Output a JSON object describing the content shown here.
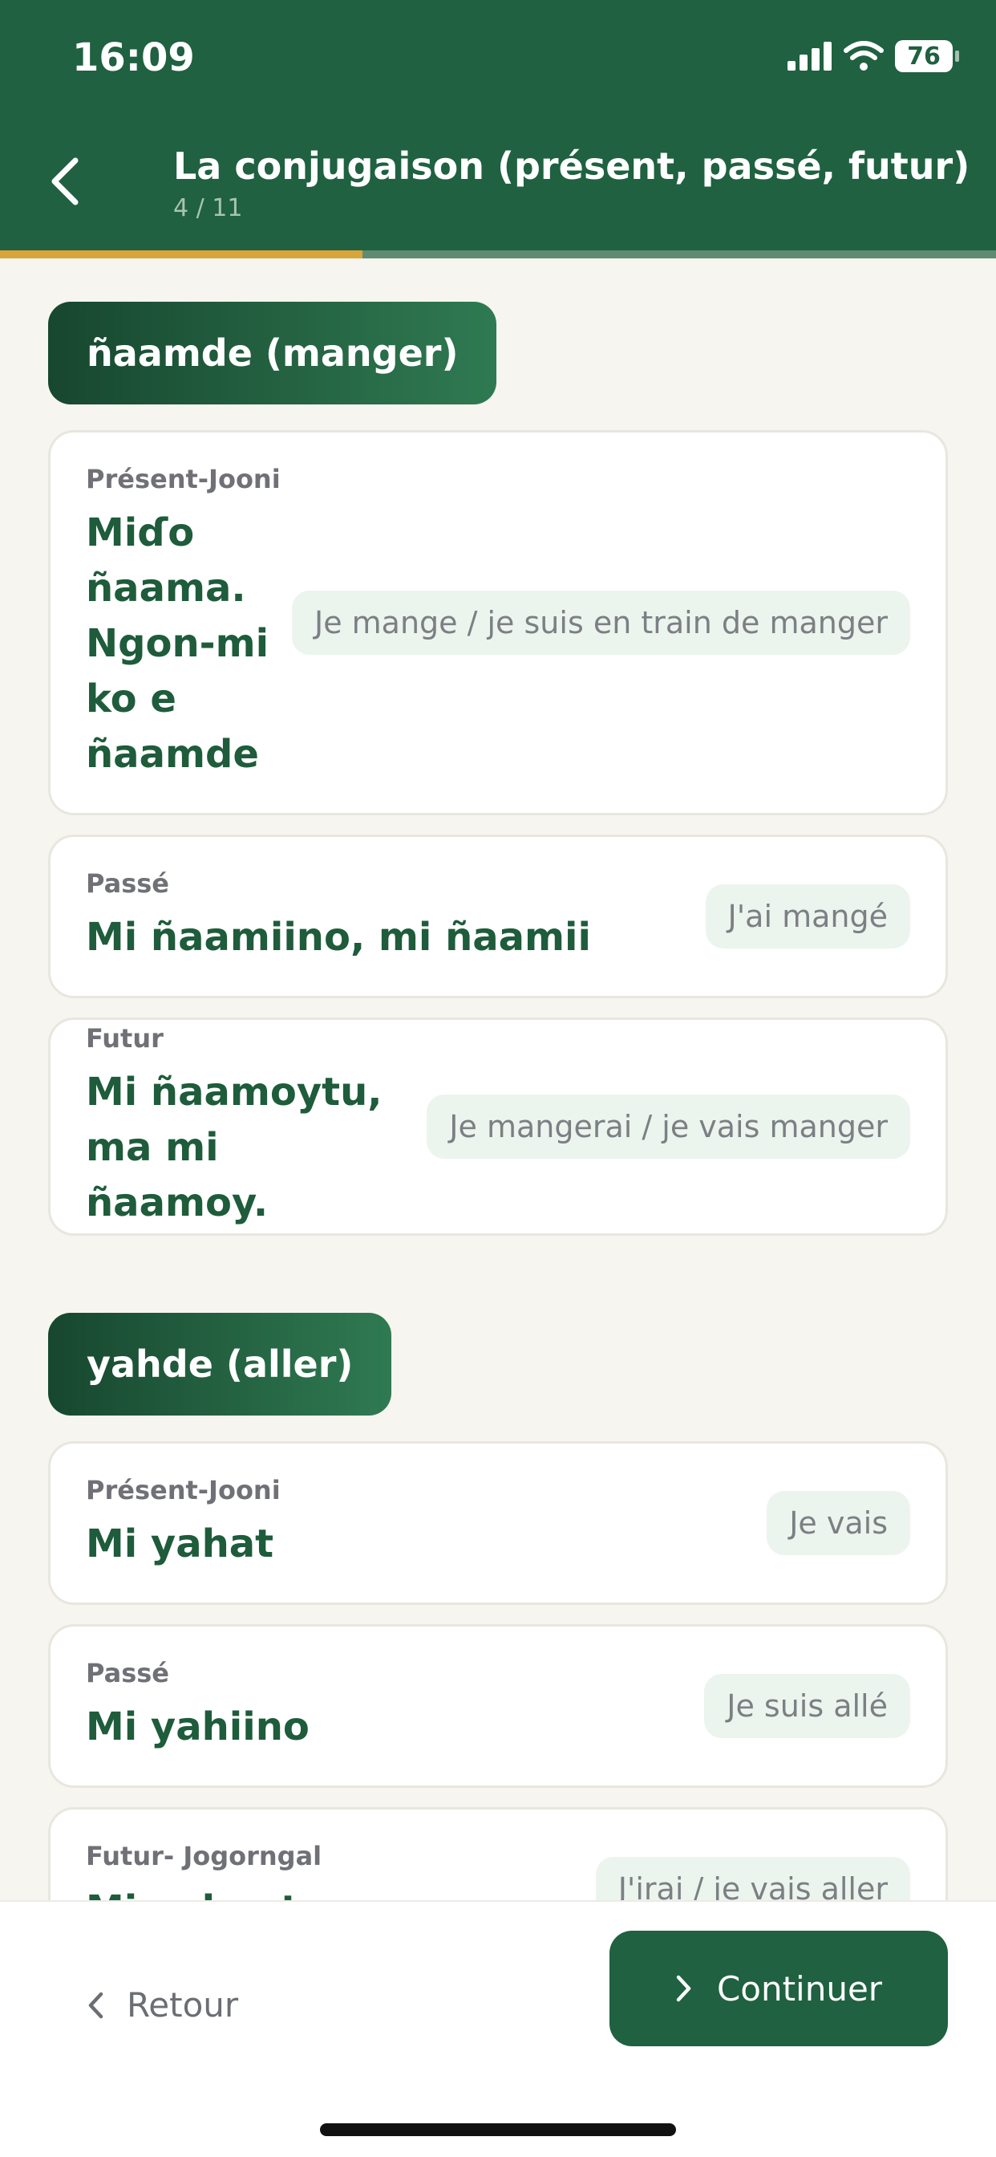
{
  "status": {
    "time": "16:09",
    "battery": "76"
  },
  "header": {
    "title": "La conjugaison (présent, passé, futur)",
    "progress_text": "4 / 11",
    "progress_fraction": 0.3636
  },
  "colors": {
    "primary": "#1f6140",
    "accent": "#d9a53a",
    "chip_bg": "#ecf4ee"
  },
  "verbs": [
    {
      "label": "ñaamde (manger)",
      "rows": [
        {
          "tense": "Présent-Jooni",
          "fulfulde": "Miɗo ñaama. Ngon-mi ko e ñaamde",
          "translation": "Je mange / je suis en train de manger"
        },
        {
          "tense": "Passé",
          "fulfulde": "Mi ñaamiino, mi ñaamii",
          "translation": "J'ai mangé"
        },
        {
          "tense": "Futur",
          "fulfulde": "Mi ñaamoytu, ma mi ñaamoy.",
          "translation": "Je mangerai / je vais manger"
        }
      ]
    },
    {
      "label": "yahde (aller)",
      "rows": [
        {
          "tense": "Présent-Jooni",
          "fulfulde": "Mi yahat",
          "translation": "Je vais"
        },
        {
          "tense": "Passé",
          "fulfulde": "Mi yahiino",
          "translation": "Je suis allé"
        },
        {
          "tense": "Futur- Jogorngal",
          "fulfulde": "Mi yahoytu",
          "translation": "J'irai / je vais aller"
        }
      ]
    }
  ],
  "footer": {
    "back_label": "Retour",
    "continue_label": "Continuer"
  }
}
